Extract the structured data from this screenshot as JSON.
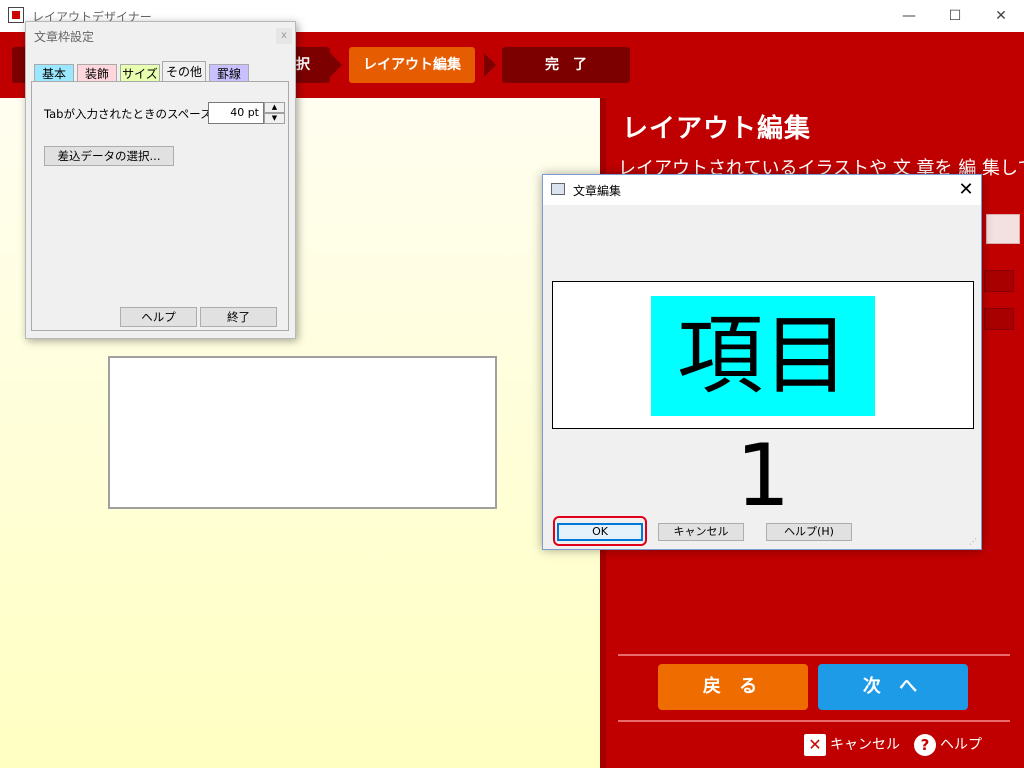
{
  "window": {
    "title": "レイアウトデザイナー",
    "minimize": "—",
    "maximize": "☐",
    "close": "✕"
  },
  "steps": [
    {
      "label": "選択",
      "state": "done",
      "visible_text": "択"
    },
    {
      "label": "レイアウト編集",
      "state": "active"
    },
    {
      "label": "完　了",
      "state": "pending"
    }
  ],
  "right_panel": {
    "title": "レイアウト編集",
    "description": "レイアウトされているイラストや 文 章を 編 集して [",
    "back_label": "戻 る",
    "next_label": "次 へ",
    "cancel_label": "キャンセル",
    "help_label": "ヘルプ"
  },
  "frame_dialog": {
    "title": "文章枠設定",
    "close": "x",
    "tabs": [
      "基本",
      "装飾",
      "サイズ",
      "その他",
      "罫線"
    ],
    "active_tab": "その他",
    "tab_colors": [
      "#9be7ff",
      "#ffd6dc",
      "#e8ffb0",
      "#f0f0f0",
      "#c8c0ff"
    ],
    "tab_spacing_label": "Tabが入力されたときのスペース幅:",
    "tab_spacing_value": "40 pt",
    "merge_data_button": "差込データの選択...",
    "help_button": "ヘルプ",
    "finish_button": "終了"
  },
  "edit_dialog": {
    "title": "文章編集",
    "close": "✕",
    "preview_text": "項目1",
    "preview_bg": "#00ffff",
    "ok_button": "OK",
    "cancel_button": "キャンセル",
    "help_button": "ヘルプ(H)"
  }
}
